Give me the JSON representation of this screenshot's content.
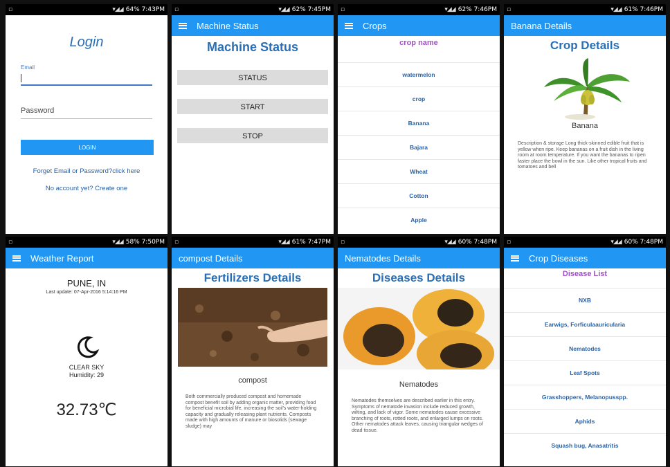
{
  "screens": {
    "login": {
      "status": {
        "left": "",
        "right": "64% 7:43PM"
      },
      "title": "Login",
      "email_label": "Email",
      "password_placeholder": "Password",
      "login_button": "LOGIN",
      "forgot_link": "Forget Email or Password?click here",
      "create_link": "No account yet? Create one"
    },
    "machine": {
      "status": {
        "left": "",
        "right": "62% 7:45PM"
      },
      "appbar_title": "Machine Status",
      "page_title": "Machine Status",
      "buttons": [
        "STATUS",
        "START",
        "STOP"
      ]
    },
    "crops": {
      "status": {
        "left": "",
        "right": "62% 7:46PM"
      },
      "appbar_title": "Crops",
      "list_header": "crop name",
      "items": [
        "watermelon",
        "crop",
        "Banana",
        "Bajara",
        "Wheat",
        "Cotton",
        "Apple"
      ]
    },
    "banana": {
      "status": {
        "left": "",
        "right": "61% 7:46PM"
      },
      "appbar_title": "Banana Details",
      "page_title": "Crop Details",
      "name": "Banana",
      "description": "Description & storage Long thick-skinned edible fruit that is yellow when ripe. Keep bananas on a fruit dish in the living room at room temperature. If you want the bananas to ripen faster place the bowl in the sun. Like other tropical fruits and tomatoes and bell"
    },
    "weather": {
      "status": {
        "left": "",
        "right": "58% 7:50PM"
      },
      "appbar_title": "Weather Report",
      "city": "PUNE, IN",
      "last_update": "Last update: 07-Apr-2016 5:14:16 PM",
      "condition": "CLEAR SKY",
      "humidity": "Humidity: 29",
      "temperature": "32.73℃"
    },
    "compost": {
      "status": {
        "left": "",
        "right": "61% 7:47PM"
      },
      "appbar_title": "compost Details",
      "page_title": "Fertilizers Details",
      "name": "compost",
      "description": "Both commercially produced compost and homemade compost benefit soil by adding organic matter, providing food for beneficial microbial life, increasing the soil's water-holding capacity and gradually releasing plant nutrients. Composts made with high amounts of manure or biosolids (sewage sludge) may"
    },
    "nematodes": {
      "status": {
        "left": "",
        "right": "60% 7:48PM"
      },
      "appbar_title": "Nematodes Details",
      "page_title": "Diseases Details",
      "name": "Nematodes",
      "description": "Nematodes themselves are described earlier in this entry. Symptoms of nematode invasion include reduced growth, wilting, and lack of vigor. Some nematodes cause excessive branching of roots, rotted roots, and enlarged lumps on roots. Other nematodes attack leaves, causing triangular wedges of dead tissue."
    },
    "diseases": {
      "status": {
        "left": "",
        "right": "60% 7:48PM"
      },
      "appbar_title": "Crop Diseases",
      "list_header": "Disease List",
      "items": [
        "NXB",
        "Earwigs, Forficulaauricularia",
        "Nematodes",
        "Leaf Spots",
        "Grasshoppers, Melanopusspp.",
        "Aphids",
        "Squash bug, Anasatritis"
      ]
    }
  },
  "colors": {
    "appbar": "#2196f3",
    "title": "#2a6fb6",
    "list_header": "#a04fc5",
    "link": "#2b62a6",
    "background": "#111111"
  }
}
